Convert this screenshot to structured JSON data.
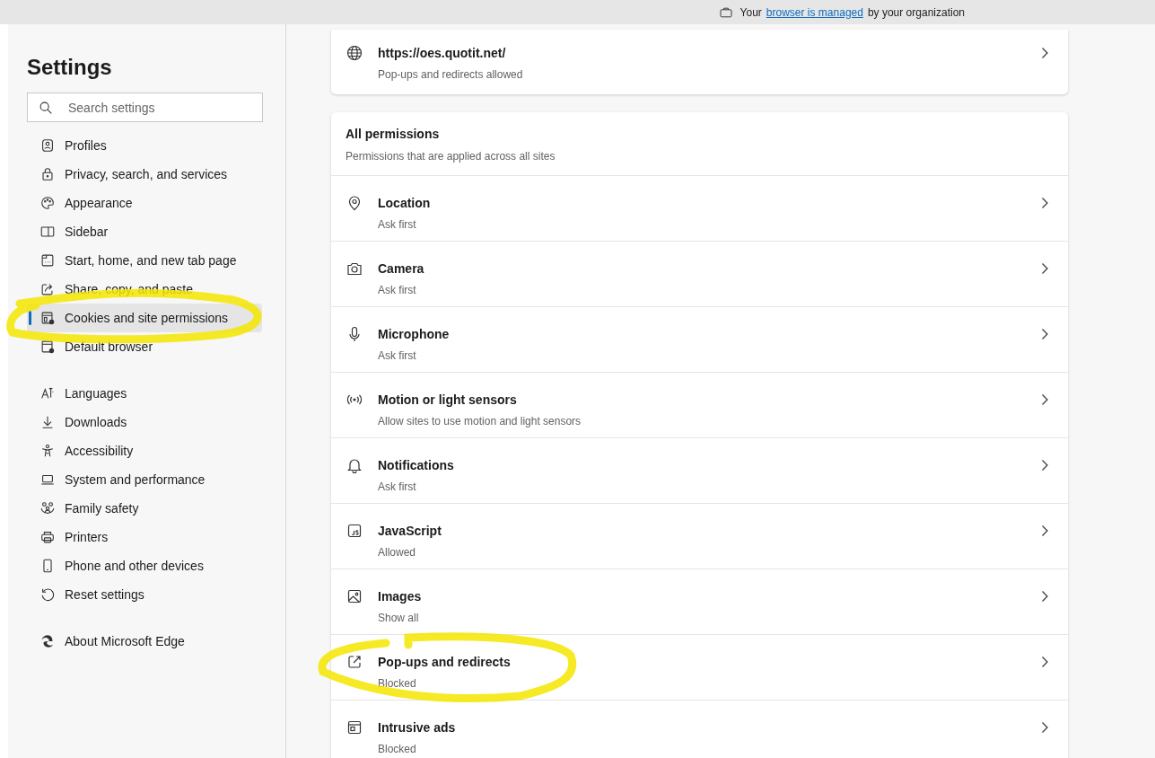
{
  "top_bar": {
    "prefix": "Your",
    "link": "browser is managed",
    "suffix": "by your organization"
  },
  "sidebar": {
    "title": "Settings",
    "search": {
      "placeholder": "Search settings"
    },
    "groups": [
      [
        {
          "label": "Profiles",
          "selected": false
        },
        {
          "label": "Privacy, search, and services",
          "selected": false
        },
        {
          "label": "Appearance",
          "selected": false
        },
        {
          "label": "Sidebar",
          "selected": false
        },
        {
          "label": "Start, home, and new tab page",
          "selected": false
        },
        {
          "label": "Share, copy, and paste",
          "selected": false
        },
        {
          "label": "Cookies and site permissions",
          "selected": true
        },
        {
          "label": "Default browser",
          "selected": false
        }
      ],
      [
        {
          "label": "Languages",
          "selected": false
        },
        {
          "label": "Downloads",
          "selected": false
        },
        {
          "label": "Accessibility",
          "selected": false
        },
        {
          "label": "System and performance",
          "selected": false
        },
        {
          "label": "Family safety",
          "selected": false
        },
        {
          "label": "Printers",
          "selected": false
        },
        {
          "label": "Phone and other devices",
          "selected": false
        },
        {
          "label": "Reset settings",
          "selected": false
        }
      ],
      [
        {
          "label": "About Microsoft Edge",
          "selected": false
        }
      ]
    ]
  },
  "site_card": {
    "title": "https://oes.quotit.net/",
    "subtitle": "Pop-ups and redirects allowed"
  },
  "permissions": {
    "title": "All permissions",
    "subtitle": "Permissions that are applied across all sites",
    "rows": [
      {
        "title": "Location",
        "status": "Ask first"
      },
      {
        "title": "Camera",
        "status": "Ask first"
      },
      {
        "title": "Microphone",
        "status": "Ask first"
      },
      {
        "title": "Motion or light sensors",
        "status": "Allow sites to use motion and light sensors"
      },
      {
        "title": "Notifications",
        "status": "Ask first"
      },
      {
        "title": "JavaScript",
        "status": "Allowed"
      },
      {
        "title": "Images",
        "status": "Show all"
      },
      {
        "title": "Pop-ups and redirects",
        "status": "Blocked"
      },
      {
        "title": "Intrusive ads",
        "status": "Blocked"
      }
    ]
  }
}
